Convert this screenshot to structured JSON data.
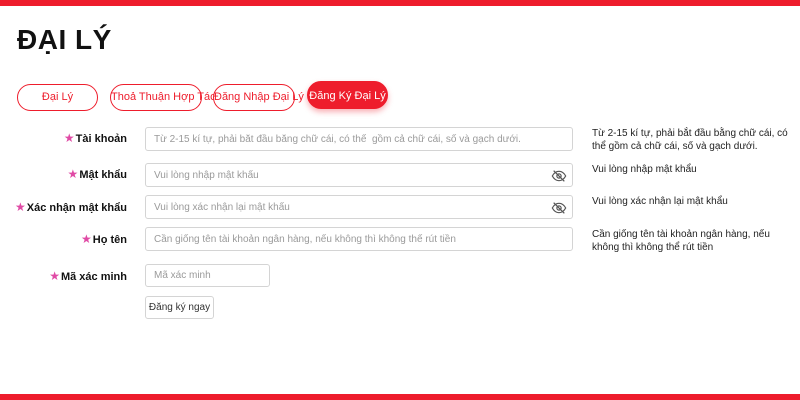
{
  "page": {
    "title": "ĐẠI LÝ"
  },
  "colors": {
    "accent": "#ee1d2c",
    "required_star": "#e04aa5"
  },
  "tabs": [
    {
      "label": "Đại Lý",
      "active": false
    },
    {
      "label": "Thoả Thuận Hợp Tác",
      "active": false
    },
    {
      "label": "Đăng Nhập Đại Lý",
      "active": false
    },
    {
      "label": "Đăng Ký Đại Lý",
      "active": true
    }
  ],
  "form": {
    "required_mark": "★",
    "account": {
      "label": "Tài khoản",
      "placeholder": "Từ 2-15 kí tự, phải bắt đầu bằng chữ cái, có thể  gồm cả chữ cái, số và gạch dưới.",
      "value": "",
      "hint": "Từ 2-15 kí tự, phải bắt đầu bằng chữ cái, có thể gồm cả chữ cái, số và gạch dưới."
    },
    "password": {
      "label": "Mật khẩu",
      "placeholder": "Vui lòng nhập mật khẩu",
      "value": "",
      "icon": "eye-off-icon",
      "hint": "Vui lòng nhập mật khẩu"
    },
    "confirm_password": {
      "label": "Xác nhận mật khẩu",
      "placeholder": "Vui lòng xác nhận lại mật khẩu",
      "value": "",
      "icon": "eye-off-icon",
      "hint": "Vui lòng xác nhận lại mật khẩu"
    },
    "full_name": {
      "label": "Họ tên",
      "placeholder": "Cần giống tên tài khoản ngân hàng, nếu không thì không thể rút tiền",
      "value": "",
      "hint": "Cần giống tên tài khoản ngân hàng, nếu không thì không thể rút tiền"
    },
    "captcha": {
      "label": "Mã xác minh",
      "placeholder": "Mã xác minh",
      "value": ""
    },
    "submit_label": "Đăng ký ngay"
  }
}
